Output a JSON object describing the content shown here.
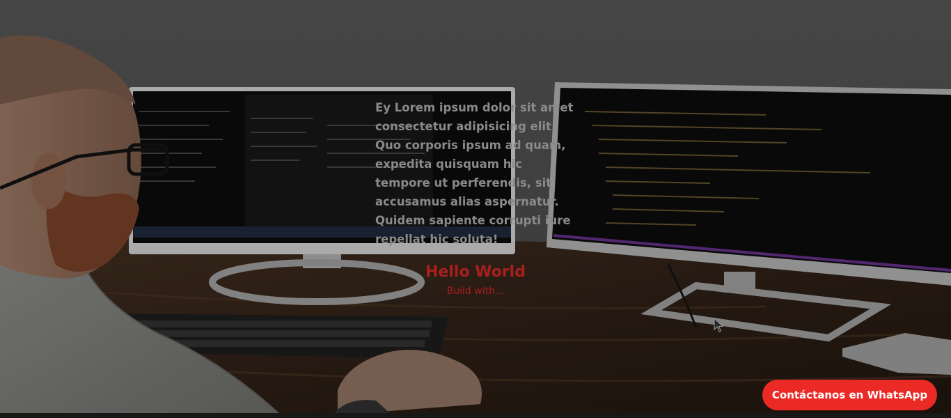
{
  "hero": {
    "paragraph": "Ey Lorem ipsum dolor sit amet consectetur adipisicing elit. Quo corporis ipsum ad quam, expedita quisquam hic tempore ut perferendis, sit accusamus alias aspernatur. Quidem sapiente corrupti iure repellat hic soluta!",
    "title": "Hello World",
    "subtitle": "Build with..."
  },
  "whatsapp": {
    "label": "Contáctanos en WhatsApp"
  },
  "colors": {
    "accent": "#ec2a25",
    "title": "#a8201d",
    "paragraph": "#8a8a8a"
  },
  "icons": {
    "cursor": "mouse-pointer-icon"
  }
}
